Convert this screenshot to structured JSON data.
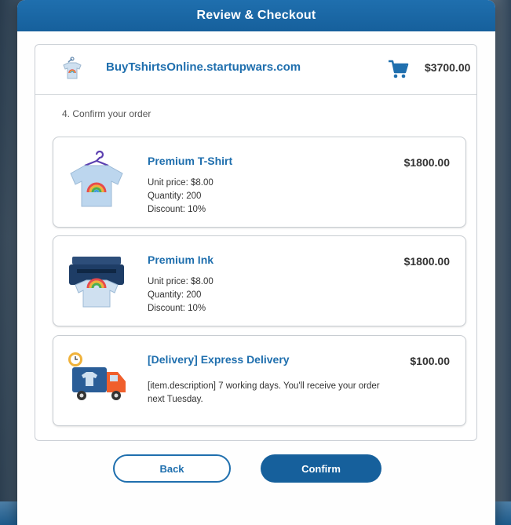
{
  "window": {
    "title": "Review & Checkout"
  },
  "store": {
    "name": "BuyTshirtsOnline.startupwars.com",
    "cart_total": "$3700.00"
  },
  "step_label": "4. Confirm your order",
  "items": [
    {
      "title": "Premium T-Shirt",
      "unit_price": "Unit price: $8.00",
      "quantity": "Quantity: 200",
      "discount": "Discount: 10%",
      "price": "$1800.00",
      "icon": "tshirt-hanger-icon"
    },
    {
      "title": "Premium Ink",
      "unit_price": "Unit price: $8.00",
      "quantity": "Quantity: 200",
      "discount": "Discount: 10%",
      "price": "$1800.00",
      "icon": "printer-icon"
    },
    {
      "title": "[Delivery] Express Delivery",
      "description": "[item.description] 7 working days. You'll receive your order next Tuesday.",
      "price": "$100.00",
      "icon": "delivery-truck-icon"
    }
  ],
  "buttons": {
    "back": "Back",
    "confirm": "Confirm"
  },
  "colors": {
    "accent": "#1f6fae",
    "accent_dark": "#16609c"
  }
}
